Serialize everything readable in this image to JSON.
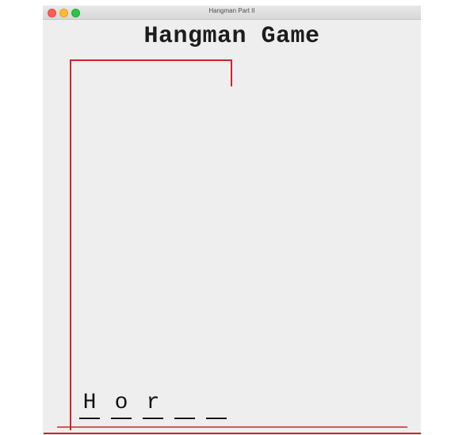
{
  "window": {
    "title": "Hangman Part II",
    "controls": [
      "close",
      "minimize",
      "zoom"
    ]
  },
  "game": {
    "title": "Hangman Game",
    "gallows_color": "#d0232a",
    "slots": [
      {
        "letter": "H",
        "revealed": true
      },
      {
        "letter": "o",
        "revealed": true
      },
      {
        "letter": "r",
        "revealed": true
      },
      {
        "letter": "",
        "revealed": false
      },
      {
        "letter": "",
        "revealed": false
      }
    ]
  }
}
